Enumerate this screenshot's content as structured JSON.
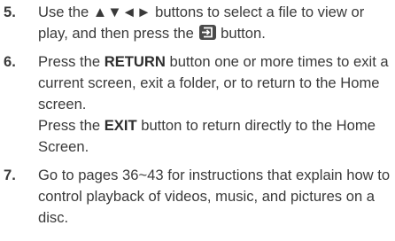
{
  "steps": [
    {
      "number": "5.",
      "text_before": "Use the ▲▼◄► buttons to select a file to view or play, and then press the ",
      "icon": "enter-icon",
      "text_after": " button."
    },
    {
      "number": "6.",
      "p1_a": "Press the ",
      "p1_kw": "RETURN",
      "p1_b": " button one or more times to exit a current screen, exit a folder, or to return to the Home screen.",
      "p2_a": "Press the ",
      "p2_kw": "EXIT",
      "p2_b": " button to return directly to the Home Screen."
    },
    {
      "number": "7.",
      "text": "Go to pages 36~43 for instructions that explain how to control playback of videos, music, and pictures on a disc."
    }
  ]
}
